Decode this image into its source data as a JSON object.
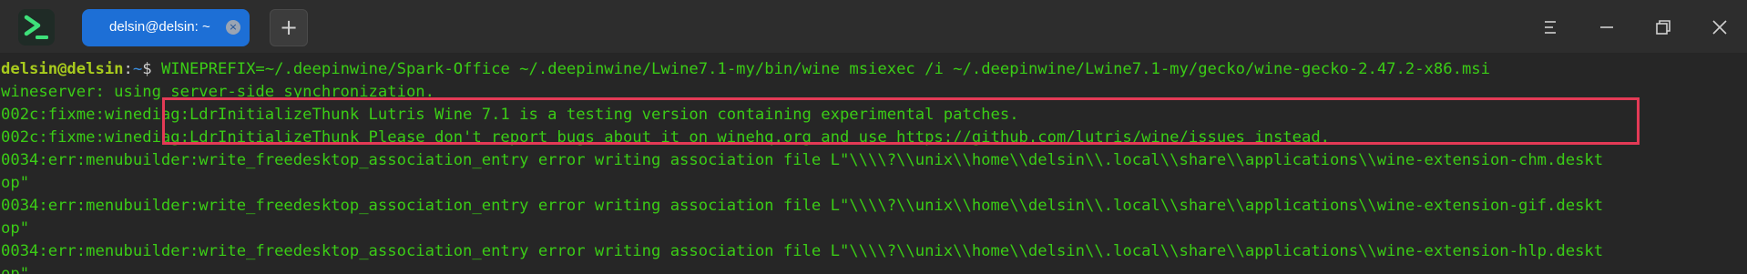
{
  "app": {
    "logo_icon": "terminal-logo-icon",
    "accent_color": "#1d6fd6"
  },
  "tabs": [
    {
      "label": "delsin@delsin: ~",
      "active": true,
      "close_icon": "close-icon"
    }
  ],
  "new_tab": {
    "label": "+"
  },
  "window_controls": {
    "menu_icon": "menu-icon",
    "minimize_icon": "minimize-icon",
    "restore_icon": "restore-icon",
    "close_icon": "close-icon"
  },
  "terminal": {
    "prompt": {
      "user_host": "delsin@delsin",
      "colon": ":",
      "path": "~",
      "symbol": "$"
    },
    "command": " WINEPREFIX=~/.deepinwine/Spark-Office ~/.deepinwine/Lwine7.1-my/bin/wine msiexec /i ~/.deepinwine/Lwine7.1-my/gecko/wine-gecko-2.47.2-x86.msi",
    "output": [
      "wineserver: using server-side synchronization.",
      "002c:fixme:winediag:LdrInitializeThunk Lutris Wine 7.1 is a testing version containing experimental patches.",
      "002c:fixme:winediag:LdrInitializeThunk Please don't report bugs about it on winehq.org and use https://github.com/lutris/wine/issues instead.",
      "0034:err:menubuilder:write_freedesktop_association_entry error writing association file L\"\\\\\\\\?\\\\unix\\\\home\\\\delsin\\\\.local\\\\share\\\\applications\\\\wine-extension-chm.deskt",
      "op\"",
      "0034:err:menubuilder:write_freedesktop_association_entry error writing association file L\"\\\\\\\\?\\\\unix\\\\home\\\\delsin\\\\.local\\\\share\\\\applications\\\\wine-extension-gif.deskt",
      "op\"",
      "0034:err:menubuilder:write_freedesktop_association_entry error writing association file L\"\\\\\\\\?\\\\unix\\\\home\\\\delsin\\\\.local\\\\share\\\\applications\\\\wine-extension-hlp.deskt",
      "op\""
    ],
    "colors": {
      "output": "#3bcc16",
      "user_host": "#a8cb1d",
      "path": "#3c8fe0",
      "highlight": "#e33a56"
    }
  }
}
